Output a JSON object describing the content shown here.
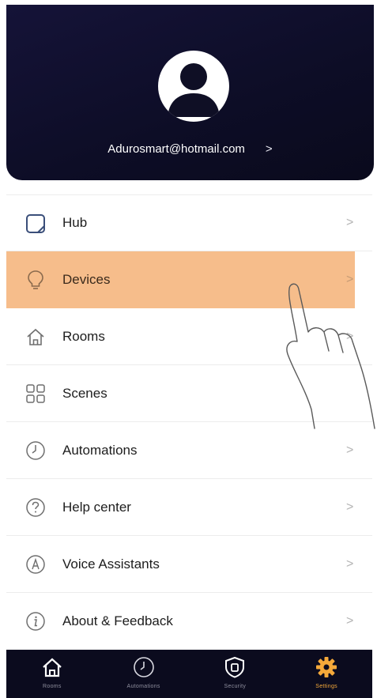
{
  "header": {
    "email": "Adurosmart@hotmail.com",
    "email_chevron": ">"
  },
  "menu": {
    "items": [
      {
        "key": "hub",
        "label": "Hub",
        "icon": "hub-icon",
        "chevron": ">"
      },
      {
        "key": "devices",
        "label": "Devices",
        "icon": "bulb-icon",
        "chevron": ">"
      },
      {
        "key": "rooms",
        "label": "Rooms",
        "icon": "house-icon",
        "chevron": ">"
      },
      {
        "key": "scenes",
        "label": "Scenes",
        "icon": "grid-icon",
        "chevron": ""
      },
      {
        "key": "automations",
        "label": "Automations",
        "icon": "clock-icon",
        "chevron": ">"
      },
      {
        "key": "help",
        "label": "Help center",
        "icon": "question-icon",
        "chevron": ">"
      },
      {
        "key": "voice",
        "label": "Voice Assistants",
        "icon": "voice-icon",
        "chevron": ">"
      },
      {
        "key": "about",
        "label": "About & Feedback",
        "icon": "info-icon",
        "chevron": ">"
      }
    ],
    "active": "devices"
  },
  "tabbar": {
    "tabs": [
      {
        "label": "Rooms",
        "icon": "home-icon"
      },
      {
        "label": "Automations",
        "icon": "clock-icon"
      },
      {
        "label": "Security",
        "icon": "shield-icon"
      },
      {
        "label": "Settings",
        "icon": "gear-icon"
      }
    ],
    "active": "Settings"
  },
  "colors": {
    "header_bg": "#0d0d26",
    "highlight": "#f6bd8b",
    "tab_active": "#f5a93a",
    "tabbar_bg": "#0b0b1e"
  }
}
